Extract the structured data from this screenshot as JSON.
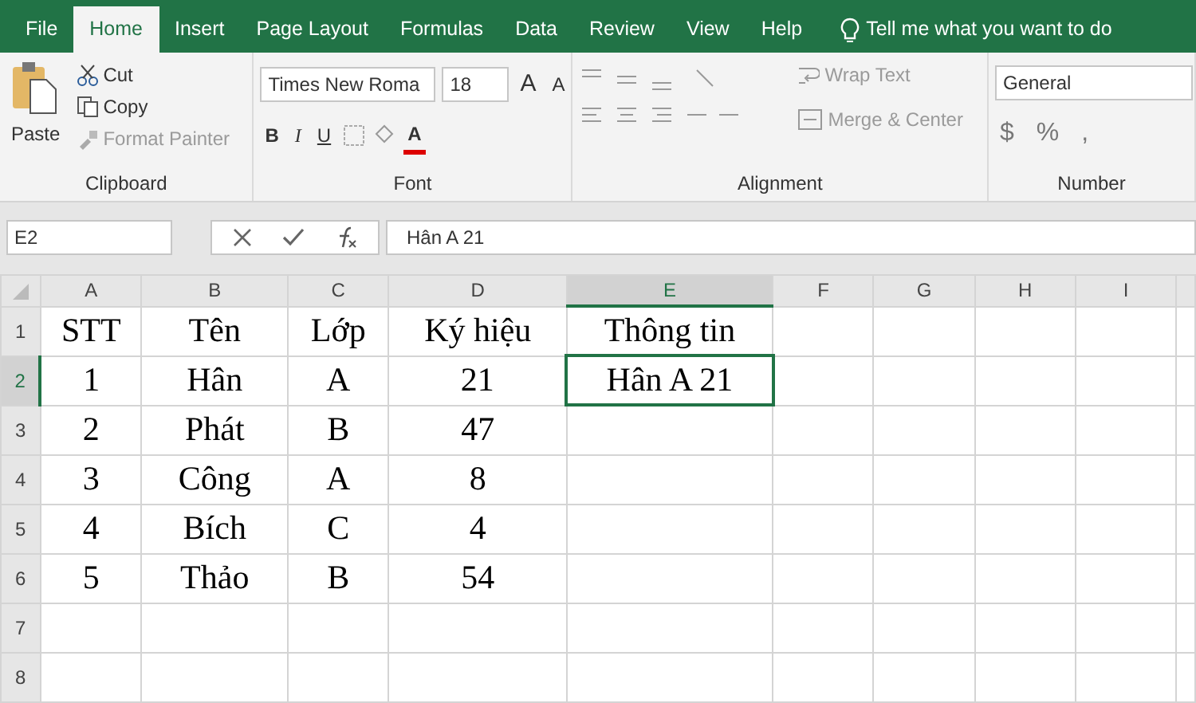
{
  "tabs": [
    {
      "label": "File",
      "selected": false
    },
    {
      "label": "Home",
      "selected": true
    },
    {
      "label": "Insert",
      "selected": false
    },
    {
      "label": "Page Layout",
      "selected": false
    },
    {
      "label": "Formulas",
      "selected": false
    },
    {
      "label": "Data",
      "selected": false
    },
    {
      "label": "Review",
      "selected": false
    },
    {
      "label": "View",
      "selected": false
    },
    {
      "label": "Help",
      "selected": false
    }
  ],
  "tell_me": "Tell me what you want to do",
  "clipboard": {
    "title": "Clipboard",
    "paste": "Paste",
    "cut": "Cut",
    "copy": "Copy",
    "format_painter": {
      "label": "Format Painter",
      "disabled": true
    }
  },
  "font": {
    "title": "Font",
    "font_name": "Times New Roma",
    "font_size": "18",
    "grow": "A",
    "shrink": "A",
    "bold": "B",
    "italic": "I",
    "underline": "U",
    "font_color": "A"
  },
  "alignment": {
    "title": "Alignment",
    "wrap_text": "Wrap Text",
    "merge_center": "Merge & Center"
  },
  "number": {
    "title": "Number",
    "format": "General",
    "currency": "$",
    "percent": "%",
    "comma": ","
  },
  "name_box": "E2",
  "formula": "Hân A 21",
  "columns": [
    {
      "label": "A",
      "selected": false
    },
    {
      "label": "B",
      "selected": false
    },
    {
      "label": "C",
      "selected": false
    },
    {
      "label": "D",
      "selected": false
    },
    {
      "label": "E",
      "selected": true
    },
    {
      "label": "F",
      "selected": false
    },
    {
      "label": "G",
      "selected": false
    },
    {
      "label": "H",
      "selected": false
    },
    {
      "label": "I",
      "selected": false
    }
  ],
  "rows": [
    {
      "number": "1",
      "selected": false,
      "cells": [
        {
          "text": "STT",
          "selected": false
        },
        {
          "text": "Tên",
          "selected": false
        },
        {
          "text": "Lớp",
          "selected": false
        },
        {
          "text": "Ký hiệu",
          "selected": false
        },
        {
          "text": "Thông tin",
          "selected": false
        }
      ]
    },
    {
      "number": "2",
      "selected": true,
      "cells": [
        {
          "text": "1",
          "selected": false
        },
        {
          "text": "Hân",
          "selected": false
        },
        {
          "text": "A",
          "selected": false
        },
        {
          "text": "21",
          "selected": false
        },
        {
          "text": "Hân A 21",
          "selected": true
        }
      ]
    },
    {
      "number": "3",
      "selected": false,
      "cells": [
        {
          "text": "2",
          "selected": false
        },
        {
          "text": "Phát",
          "selected": false
        },
        {
          "text": "B",
          "selected": false
        },
        {
          "text": "47",
          "selected": false
        }
      ]
    },
    {
      "number": "4",
      "selected": false,
      "cells": [
        {
          "text": "3",
          "selected": false
        },
        {
          "text": "Công",
          "selected": false
        },
        {
          "text": "A",
          "selected": false
        },
        {
          "text": "8",
          "selected": false
        }
      ]
    },
    {
      "number": "5",
      "selected": false,
      "cells": [
        {
          "text": "4",
          "selected": false
        },
        {
          "text": "Bích",
          "selected": false
        },
        {
          "text": "C",
          "selected": false
        },
        {
          "text": "4",
          "selected": false
        }
      ]
    },
    {
      "number": "6",
      "selected": false,
      "cells": [
        {
          "text": "5",
          "selected": false
        },
        {
          "text": "Thảo",
          "selected": false
        },
        {
          "text": "B",
          "selected": false
        },
        {
          "text": "54",
          "selected": false
        }
      ]
    },
    {
      "number": "7",
      "selected": false,
      "cells": []
    },
    {
      "number": "8",
      "selected": false,
      "cells": []
    }
  ]
}
